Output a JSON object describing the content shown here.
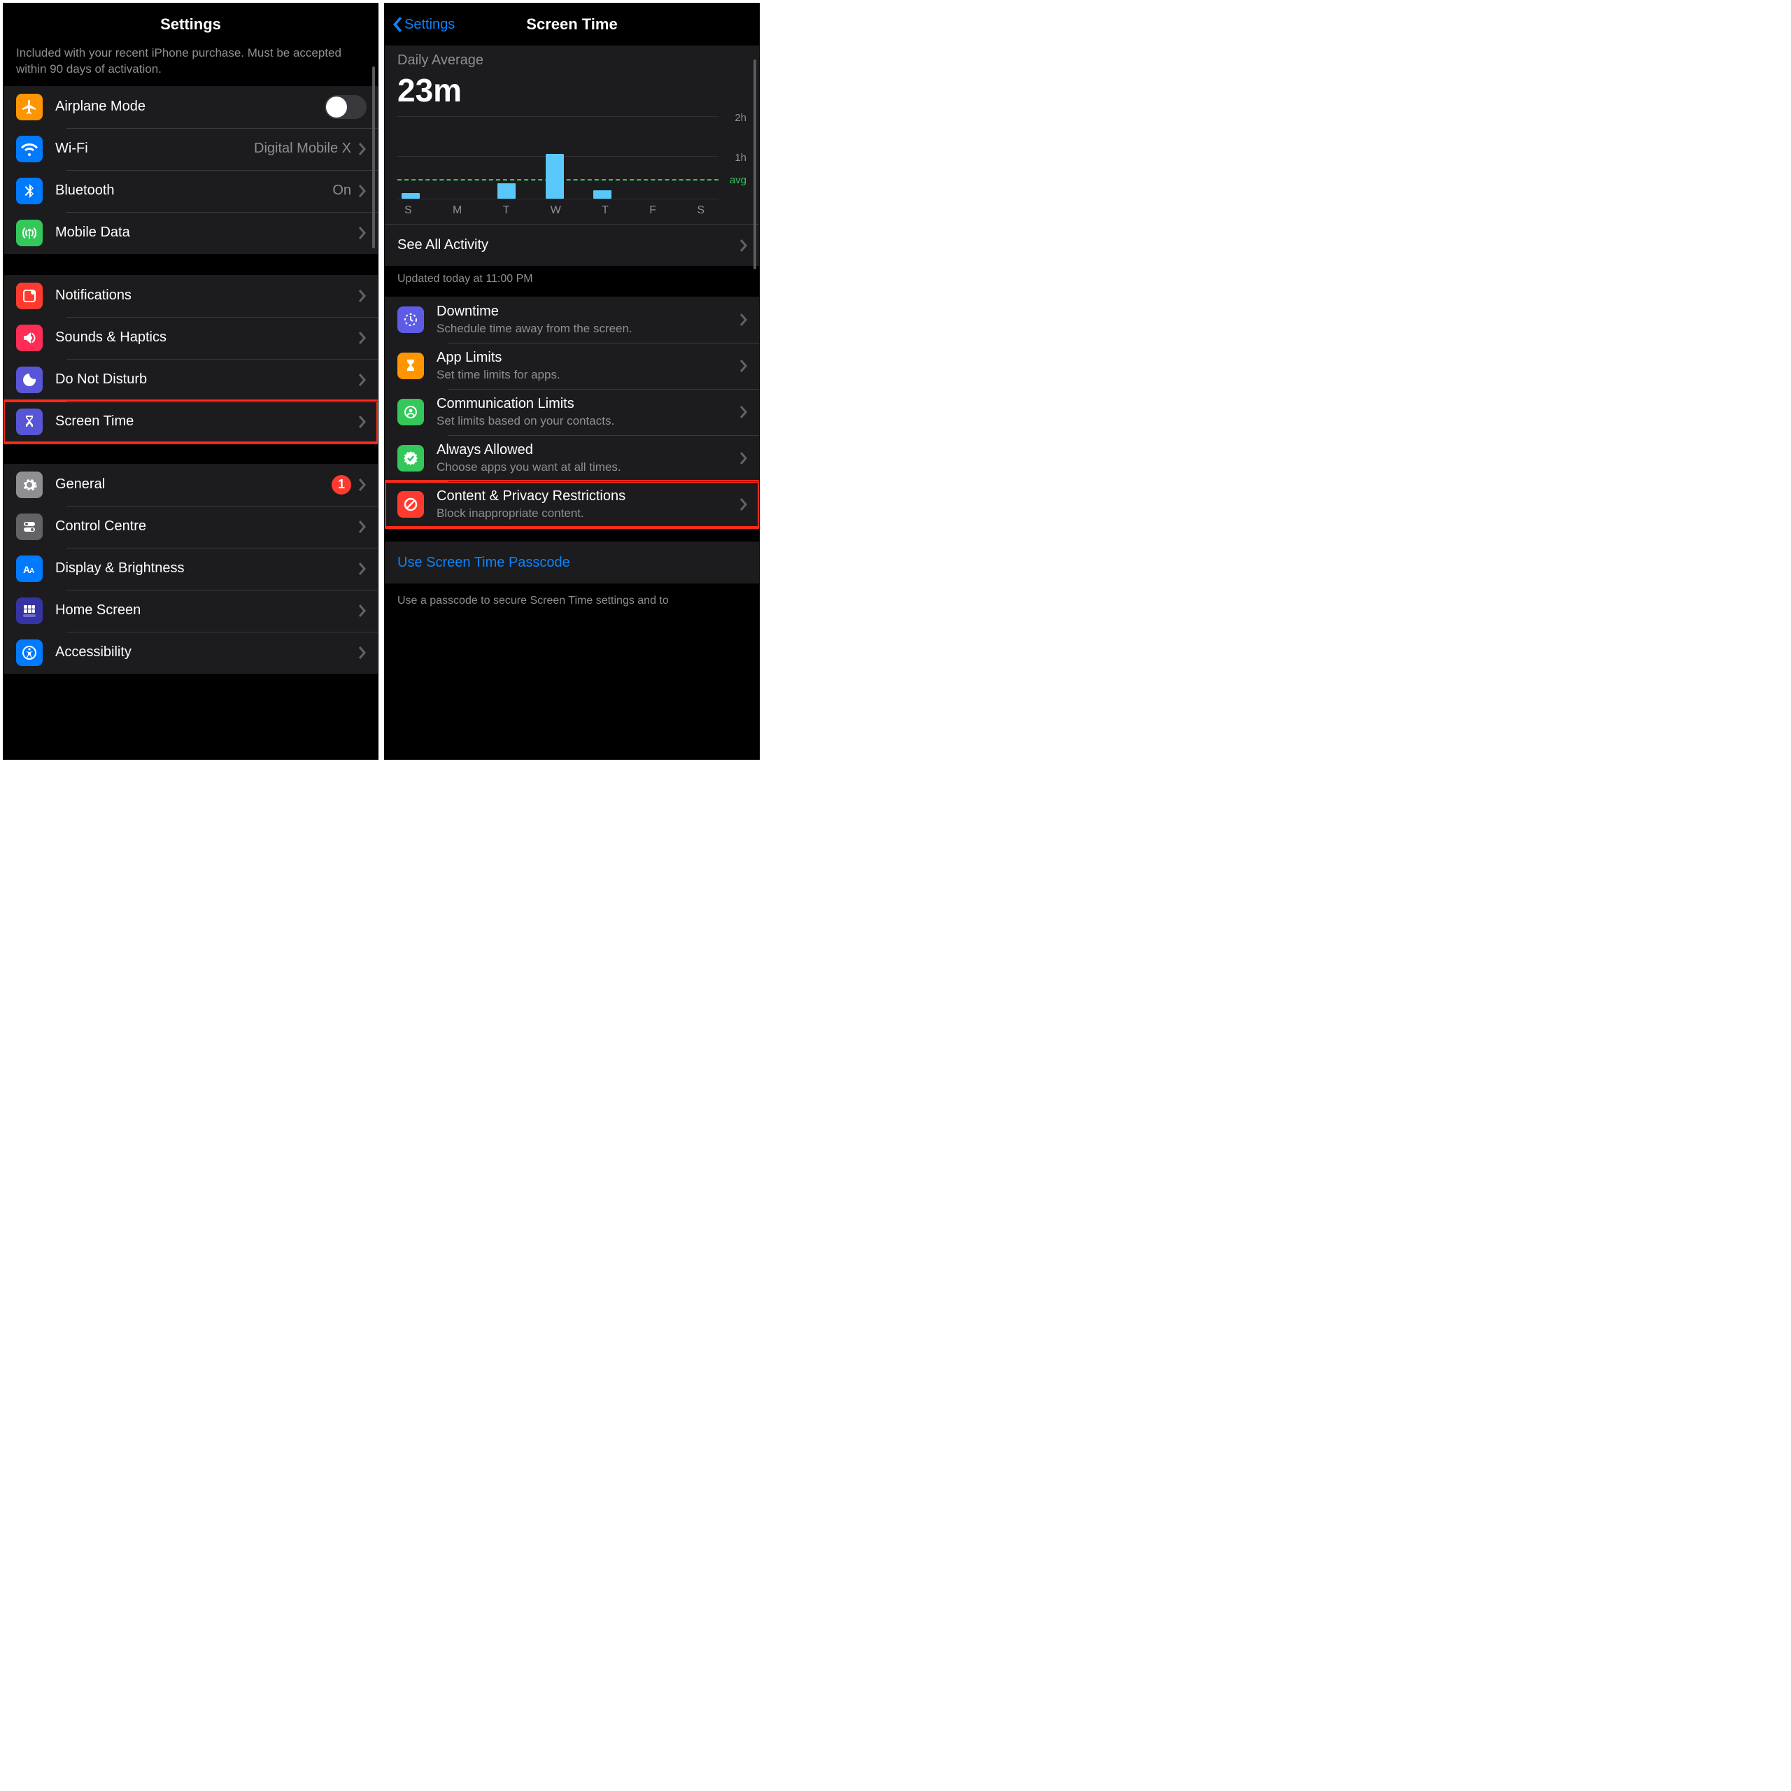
{
  "left": {
    "title": "Settings",
    "header_note": "Included with your recent iPhone purchase. Must be accepted within 90 days of activation.",
    "connectivity": {
      "airplane": {
        "label": "Airplane Mode",
        "on": false
      },
      "wifi": {
        "label": "Wi-Fi",
        "value": "Digital Mobile X"
      },
      "bluetooth": {
        "label": "Bluetooth",
        "value": "On"
      },
      "mobile_data": {
        "label": "Mobile Data"
      }
    },
    "system1": {
      "notifications": {
        "label": "Notifications"
      },
      "sounds": {
        "label": "Sounds & Haptics"
      },
      "dnd": {
        "label": "Do Not Disturb"
      },
      "screentime": {
        "label": "Screen Time"
      }
    },
    "system2": {
      "general": {
        "label": "General",
        "badge": "1"
      },
      "controlcentre": {
        "label": "Control Centre"
      },
      "display": {
        "label": "Display & Brightness"
      },
      "homescreen": {
        "label": "Home Screen"
      },
      "accessibility": {
        "label": "Accessibility"
      }
    }
  },
  "right": {
    "back": "Settings",
    "title": "Screen Time",
    "daily_average_label": "Daily Average",
    "daily_average_value": "23m",
    "chart_ylabels": {
      "h2": "2h",
      "h1": "1h",
      "avg": "avg"
    },
    "see_all": "See All Activity",
    "updated": "Updated today at 11:00 PM",
    "items": {
      "downtime": {
        "title": "Downtime",
        "sub": "Schedule time away from the screen."
      },
      "applimits": {
        "title": "App Limits",
        "sub": "Set time limits for apps."
      },
      "commlimits": {
        "title": "Communication Limits",
        "sub": "Set limits based on your contacts."
      },
      "alwaysallowed": {
        "title": "Always Allowed",
        "sub": "Choose apps you want at all times."
      },
      "contentpriv": {
        "title": "Content & Privacy Restrictions",
        "sub": "Block inappropriate content."
      }
    },
    "passcode": "Use Screen Time Passcode",
    "passcode_note": "Use a passcode to secure Screen Time settings and to"
  },
  "chart_data": {
    "type": "bar",
    "title": "Daily Average 23m",
    "xlabel": "",
    "ylabel": "hours",
    "ylim": [
      0,
      2
    ],
    "avg_line_minutes": 23,
    "categories": [
      "S",
      "M",
      "T",
      "W",
      "T",
      "F",
      "S"
    ],
    "values_minutes": [
      8,
      0,
      22,
      65,
      12,
      0,
      0
    ]
  }
}
